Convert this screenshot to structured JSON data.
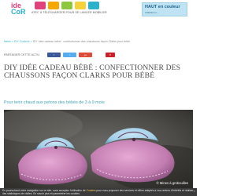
{
  "header": {
    "logo_top": "ide",
    "logo_bottom": "CoR",
    "nav_text": "ATEC  À TÉLÉCHARGER  POUR SE LANCER  MOBILIER",
    "nav_icon_colors": [
      "#e0427e",
      "#f6a800",
      "#8ec63f",
      "#f6d23a",
      "#2bb1c9"
    ],
    "promo_title": "HAUT en couleur",
    "promo_sub": "collection n..."
  },
  "breadcrumb": {
    "prefix": "Idées > DIY Couture > ",
    "current": "DIY Idée cadeau bébé : confectionner des chaussons façon Clarks pour bébé"
  },
  "share": {
    "label": "PARTAGER CETTE ACTU",
    "buttons": [
      {
        "label": "f",
        "color": "#3b5998"
      },
      {
        "label": "t",
        "color": "#55acee"
      },
      {
        "label": "g+",
        "color": "#dd4b39"
      },
      {
        "label": "P",
        "color": "#cb2027"
      }
    ]
  },
  "article": {
    "title": "DIY IDÉE CADEAU BÉBÉ : CONFECTIONNER DES CHAUSSONS FAÇON CLARKS POUR BÉBÉ",
    "subtitle": "Pour tenir chaud aux petons des bébés de 3 à 9 mois",
    "photo_credit": "© Mines à grobouilles"
  },
  "cookie_banner": {
    "text_start": "En poursuivant votre navigation sur ce site, vous acceptez l'utilisation de ",
    "highlight": "Cookies",
    "text_end": " pour vous proposer des services et offres adaptés à vos centres d'intérêts et réaliser des statistiques de visites. En savoir plus et paramétrer les cookies.",
    "close": "×"
  }
}
